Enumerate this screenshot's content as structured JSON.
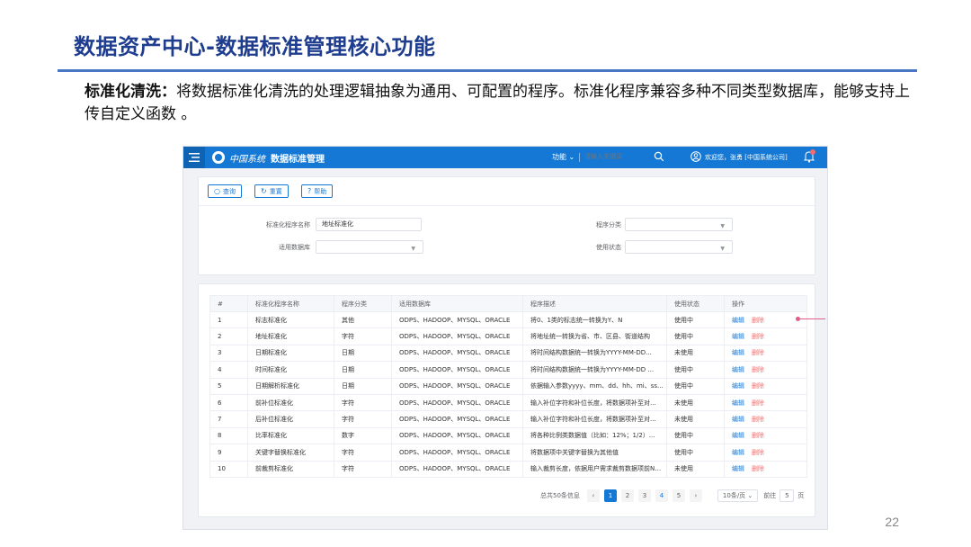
{
  "slide": {
    "title": "数据资产中心-数据标准管理核心功能",
    "intro_bold": "标准化清洗：",
    "intro_text": "将数据标准化清洗的处理逻辑抽象为通用、可配置的程序。标准化程序兼容多种不同类型数据库，能够支持上传自定义函数 。",
    "page_number": "22"
  },
  "app": {
    "brand": "中国系统",
    "module_title": "数据标准管理",
    "function_menu": "功能",
    "keyword_placeholder": "请输入关键词",
    "welcome": "欢迎您，张勇 [中国系统公司]",
    "colors": {
      "topbar": "#1478d4",
      "primary": "#1478d4",
      "danger": "#f56c6c"
    },
    "icons": [
      "menu-icon",
      "logo-icon",
      "chevron-down-icon",
      "search-icon",
      "user-icon",
      "bell-icon"
    ]
  },
  "toolbar": {
    "query_label": "查询",
    "reset_label": "重置",
    "help_label": "帮助"
  },
  "filters": {
    "program_name_label": "标准化程序名称",
    "program_name_value": "地址标准化",
    "program_category_label": "程序分类",
    "program_category_value": "",
    "database_label": "适用数据库",
    "database_value": "",
    "status_label": "使用状态",
    "status_value": ""
  },
  "table": {
    "headers": [
      "#",
      "标准化程序名称",
      "程序分类",
      "适用数据库",
      "程序描述",
      "使用状态",
      "操作"
    ],
    "edit_label": "编辑",
    "delete_label": "删除",
    "rows": [
      [
        "1",
        "标志标准化",
        "其他",
        "ODPS、HADOOP、MYSQL、ORACLE",
        "将0、1类的标志统一转换为Y、N",
        "使用中"
      ],
      [
        "2",
        "地址标准化",
        "字符",
        "ODPS、HADOOP、MYSQL、ORACLE",
        "将地址统一转换为省、市、区县、街道结构",
        "使用中"
      ],
      [
        "3",
        "日期标准化",
        "日期",
        "ODPS、HADOOP、MYSQL、ORACLE",
        "将时间结构数据统一转换为YYYY-MM-DD...",
        "未使用"
      ],
      [
        "4",
        "时间标准化",
        "日期",
        "ODPS、HADOOP、MYSQL、ORACLE",
        "将时间结构数据统一转换为YYYY-MM-DD ...",
        "使用中"
      ],
      [
        "5",
        "日期解析标准化",
        "日期",
        "ODPS、HADOOP、MYSQL、ORACLE",
        "依据输入参数yyyy、mm、dd、hh、mi、ss...",
        "使用中"
      ],
      [
        "6",
        "前补位标准化",
        "字符",
        "ODPS、HADOOP、MYSQL、ORACLE",
        "输入补位字符和补位长度，将数据项补至对...",
        "未使用"
      ],
      [
        "7",
        "后补位标准化",
        "字符",
        "ODPS、HADOOP、MYSQL、ORACLE",
        "输入补位字符和补位长度，将数据项补至对...",
        "未使用"
      ],
      [
        "8",
        "比率标准化",
        "数字",
        "ODPS、HADOOP、MYSQL、ORACLE",
        "将各种比例类数据值（比如：12%；1/2）...",
        "使用中"
      ],
      [
        "9",
        "关键字替换标准化",
        "字符",
        "ODPS、HADOOP、MYSQL、ORACLE",
        "将数据项中关键字替换为其他值",
        "使用中"
      ],
      [
        "10",
        "前裁剪标准化",
        "字符",
        "ODPS、HADOOP、MYSQL、ORACLE",
        "输入裁剪长度，依据用户需求裁剪数据项前N个...",
        "未使用"
      ]
    ]
  },
  "pagination": {
    "total": "总共50条信息",
    "pages": [
      "1",
      "2",
      "3",
      "4",
      "5"
    ],
    "current_page": "1",
    "page_size": "10条/页",
    "jump_prefix": "前往",
    "jump_value": "5",
    "jump_suffix": "页"
  }
}
